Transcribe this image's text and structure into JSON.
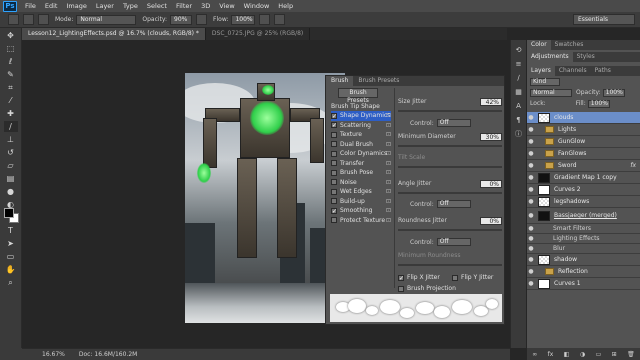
{
  "app": {
    "logo": "Ps"
  },
  "menu": [
    "File",
    "Edit",
    "Image",
    "Layer",
    "Type",
    "Select",
    "Filter",
    "3D",
    "View",
    "Window",
    "Help"
  ],
  "options": {
    "mode_label": "Mode:",
    "mode_value": "Normal",
    "opacity_label": "Opacity:",
    "opacity_value": "90%",
    "flow_label": "Flow:",
    "flow_value": "100%",
    "workspace": "Essentials"
  },
  "tabs": [
    {
      "label": "Lesson12_LightingEffects.psd @ 16.7% (clouds, RGB/8) *",
      "active": true
    },
    {
      "label": "DSC_0725.JPG @ 25% (RGB/8)",
      "active": false
    }
  ],
  "brush_panel": {
    "tabs": [
      "Brush",
      "Brush Presets"
    ],
    "presets_button": "Brush Presets",
    "header": "Brush Tip Shape",
    "items": [
      {
        "label": "Shape Dynamics",
        "checked": true,
        "selected": true
      },
      {
        "label": "Scattering",
        "checked": true,
        "selected": false
      },
      {
        "label": "Texture",
        "checked": false,
        "selected": false
      },
      {
        "label": "Dual Brush",
        "checked": false,
        "selected": false
      },
      {
        "label": "Color Dynamics",
        "checked": false,
        "selected": false
      },
      {
        "label": "Transfer",
        "checked": false,
        "selected": false
      },
      {
        "label": "Brush Pose",
        "checked": false,
        "selected": false
      },
      {
        "label": "Noise",
        "checked": false,
        "selected": false
      },
      {
        "label": "Wet Edges",
        "checked": false,
        "selected": false
      },
      {
        "label": "Build-up",
        "checked": false,
        "selected": false
      },
      {
        "label": "Smoothing",
        "checked": true,
        "selected": false
      },
      {
        "label": "Protect Texture",
        "checked": false,
        "selected": false
      }
    ],
    "settings": {
      "size_jitter_label": "Size Jitter",
      "size_jitter_value": "42%",
      "control_label": "Control:",
      "control_value": "Off",
      "min_diameter_label": "Minimum Diameter",
      "min_diameter_value": "30%",
      "tilt_scale_label": "Tilt Scale",
      "angle_jitter_label": "Angle Jitter",
      "angle_jitter_value": "0%",
      "control2_value": "Off",
      "roundness_jitter_label": "Roundness Jitter",
      "roundness_jitter_value": "0%",
      "control3_value": "Off",
      "min_roundness_label": "Minimum Roundness",
      "flip_x_label": "Flip X Jitter",
      "flip_y_label": "Flip Y Jitter",
      "brush_projection_label": "Brush Projection"
    }
  },
  "right_panel": {
    "top_tabs": [
      "Color",
      "Swatches"
    ],
    "mid_tabs": [
      "Adjustments",
      "Styles"
    ],
    "layer_tabs": [
      "Layers",
      "Channels",
      "Paths"
    ],
    "kind_label": "Kind",
    "blend_mode": "Normal",
    "opacity_label": "Opacity:",
    "opacity_value": "100%",
    "lock_label": "Lock:",
    "fill_label": "Fill:",
    "fill_value": "100%",
    "layers": [
      {
        "name": "clouds",
        "type": "pixel",
        "selected": true
      },
      {
        "name": "Lights",
        "type": "folder"
      },
      {
        "name": "GunGlow",
        "type": "folder"
      },
      {
        "name": "FanGlows",
        "type": "folder"
      },
      {
        "name": "Sword",
        "type": "folder",
        "fx": "fx"
      },
      {
        "name": "Gradient Map 1 copy",
        "type": "adjust"
      },
      {
        "name": "Curves 2",
        "type": "adjust"
      },
      {
        "name": "legshadows",
        "type": "pixel"
      },
      {
        "name": "Bassjaeger (merged)",
        "type": "smart"
      },
      {
        "name": "Smart Filters",
        "type": "sub"
      },
      {
        "name": "Lighting Effects",
        "type": "sub"
      },
      {
        "name": "Blur",
        "type": "sub"
      },
      {
        "name": "shadow",
        "type": "pixel"
      },
      {
        "name": "Reflection",
        "type": "folder"
      },
      {
        "name": "Curves 1",
        "type": "adjust"
      }
    ]
  },
  "status": {
    "zoom": "16.67%",
    "doc": "Doc: 16.6M/160.2M"
  }
}
